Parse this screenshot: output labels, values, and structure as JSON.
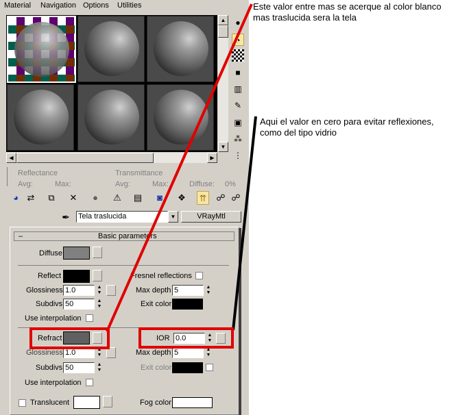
{
  "menu": [
    "Material",
    "Navigation",
    "Options",
    "Utilities"
  ],
  "preview": {
    "slots": [
      {
        "label": "slot-1",
        "kind": "glass-checker",
        "selected": true
      },
      {
        "label": "slot-2",
        "kind": "gray"
      },
      {
        "label": "slot-3",
        "kind": "gray"
      },
      {
        "label": "slot-4",
        "kind": "gray"
      },
      {
        "label": "slot-5",
        "kind": "gray"
      },
      {
        "label": "slot-6",
        "kind": "gray"
      }
    ]
  },
  "sidebar_icons": [
    "sample-type-sphere-icon",
    "backlight-icon",
    "background-checker-icon",
    "sample-uv-tiling-icon",
    "video-color-check-icon",
    "make-preview-icon",
    "options-icon",
    "select-by-material-icon",
    "material-map-navigator-icon"
  ],
  "stats": {
    "reflectance": "Reflectance",
    "transmittance": "Transmittance",
    "avg1": "Avg:",
    "max1": "Max:",
    "avg2": "Avg:",
    "max2": "Max:",
    "diffuse": "Diffuse:",
    "diffuse_value": "0%"
  },
  "toolbar_icons": [
    "get-material-icon",
    "put-to-scene-icon",
    "assign-to-selection-icon",
    "delete-icon",
    "make-unique-icon",
    "put-to-library-icon",
    "material-effects-channel-icon",
    "show-map-in-viewport-icon",
    "show-end-result-icon",
    "go-to-parent-icon",
    "go-forward-icon",
    "pick-material-icon"
  ],
  "material": {
    "name": "Tela traslucida",
    "type": "VRayMtl",
    "rollout": "Basic parameters"
  },
  "params": {
    "diffuse": "Diffuse",
    "reflect": "Reflect",
    "fresnel": "Fresnel reflections",
    "glossiness": "Glossiness",
    "gloss_value": "1.0",
    "max_depth": "Max depth",
    "max_depth_value": "5",
    "subdivs": "Subdivs",
    "subdivs_value": "50",
    "exit_color": "Exit color",
    "use_interp": "Use interpolation",
    "refract": "Refract",
    "ior": "IOR",
    "ior_value": "0.0",
    "gloss2": "Glossiness",
    "gloss2_value": "1.0",
    "max_depth2": "Max depth",
    "max_depth2_value": "5",
    "subdivs2": "Subdivs",
    "subdivs2_value": "50",
    "exit_color2": "Exit color",
    "use_interp2": "Use interpolation",
    "translucent": "Translucent",
    "fog_color": "Fog color"
  },
  "annotations": {
    "top": "Este valor entre mas se acerque al color blanco mas traslucida sera la tela",
    "middle": "Aqui el valor en cero para evitar reflexiones, como  del tipo vidrio"
  },
  "colors": {
    "panel": "#d4d0c8",
    "annotation_red": "#e00000",
    "diffuse_swatch": "#808080",
    "refract_swatch": "#606060"
  }
}
